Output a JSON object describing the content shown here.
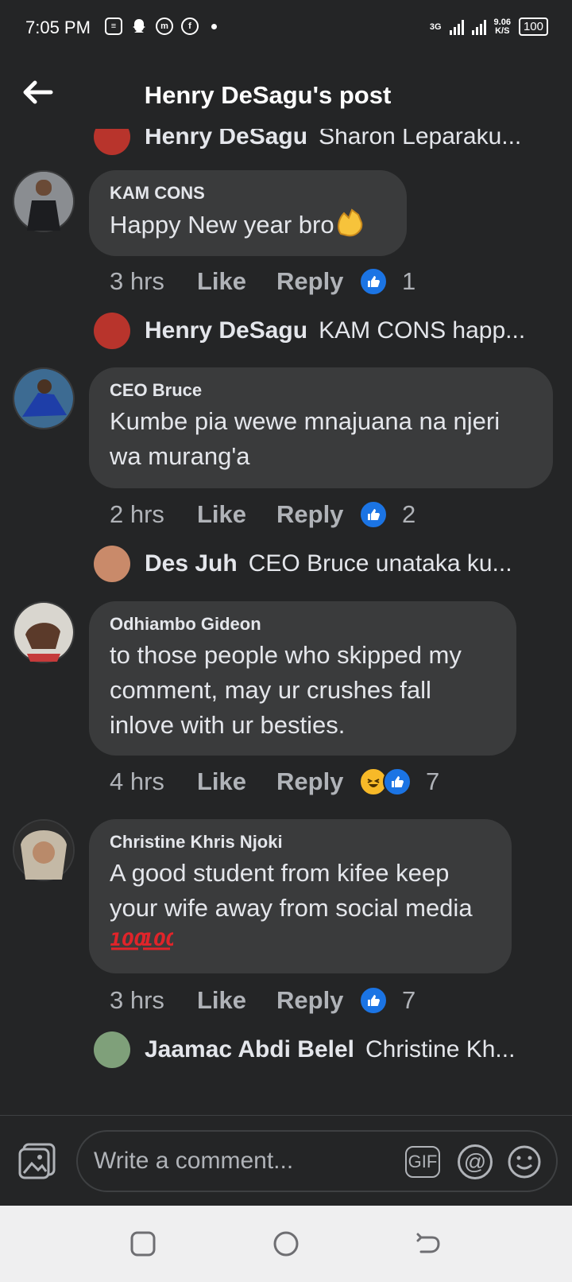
{
  "status_bar": {
    "time": "7:05 PM",
    "network_type": "3G",
    "net_speed_value": "9.06",
    "net_speed_unit": "K/S",
    "battery": "100"
  },
  "header": {
    "title": "Henry DeSagu's post",
    "back_icon": "arrow-left-icon"
  },
  "colors": {
    "background": "#242526",
    "bubble": "#3a3b3c",
    "text_primary": "#e4e6eb",
    "text_secondary": "#b0b3b8",
    "like_blue": "#1b74e4"
  },
  "thread": {
    "top_reply": {
      "name": "Henry DeSagu",
      "preview": "Sharon Leparaku..."
    },
    "comments": [
      {
        "name": "KAM CONS",
        "text": "Happy New year bro",
        "emoji": "clapping-hands",
        "time": "3 hrs",
        "like_label": "Like",
        "reply_label": "Reply",
        "reactions": [
          "like"
        ],
        "reaction_count": "1",
        "reply": {
          "name": "Henry DeSagu",
          "preview": "KAM CONS happ..."
        }
      },
      {
        "name": "CEO Bruce",
        "text": "Kumbe pia wewe mnajuana na njeri wa murang'a",
        "time": "2 hrs",
        "like_label": "Like",
        "reply_label": "Reply",
        "reactions": [
          "like"
        ],
        "reaction_count": "2",
        "reply": {
          "name": "Des Juh",
          "preview": "CEO Bruce unataka ku..."
        }
      },
      {
        "name": "Odhiambo Gideon",
        "text": "to those people who skipped my comment, may ur crushes fall inlove with ur besties.",
        "time": "4 hrs",
        "like_label": "Like",
        "reply_label": "Reply",
        "reactions": [
          "haha",
          "like"
        ],
        "reaction_count": "7"
      },
      {
        "name": "Christine Khris Njoki",
        "text": "A good student  from kifee keep your wife away from social media",
        "emoji": "hundred-points x2",
        "time": "3 hrs",
        "like_label": "Like",
        "reply_label": "Reply",
        "reactions": [
          "like"
        ],
        "reaction_count": "7",
        "reply": {
          "name": "Jaamac Abdi Belel",
          "preview": "Christine Kh..."
        }
      }
    ]
  },
  "composer": {
    "placeholder": "Write a comment...",
    "gif_label": "GIF",
    "at_label": "@"
  },
  "nav_bar": {
    "buttons": [
      "recent-apps",
      "home",
      "back"
    ]
  }
}
